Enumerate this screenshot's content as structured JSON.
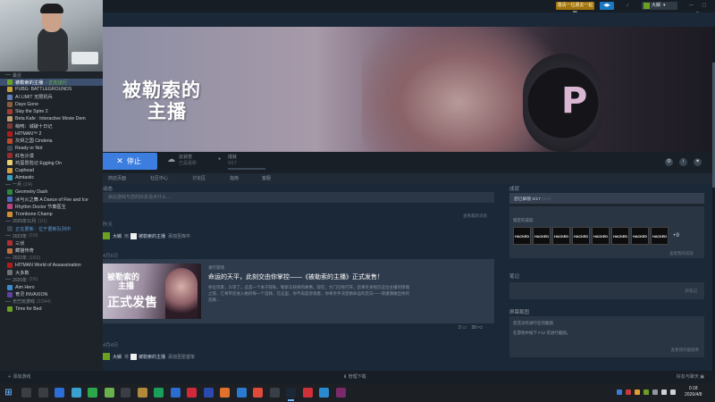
{
  "topbar": {
    "invite_label": "邀请一位朋友一起玩",
    "broadcast_icon": "broadcast-icon",
    "notification_icon": "bell-icon",
    "username": "大鳞",
    "window_controls": "— ▢ ✕"
  },
  "sidebar": {
    "sections": [
      {
        "header": "最近",
        "count": "",
        "items": [
          {
            "label": "被勒索的主播",
            "status": "- 正在运行",
            "color": "#6aa121",
            "active": true
          },
          {
            "label": "PUBG: BATTLEGROUNDS",
            "color": "#c9a13a"
          },
          {
            "label": "AI LIMIT 无限机兵",
            "color": "#5e7fb0"
          },
          {
            "label": "Days Gone",
            "color": "#8a5c3a"
          },
          {
            "label": "Slay the Spire 2",
            "color": "#a23c2e"
          },
          {
            "label": "Beta Kafe : Interactive Movie Dem",
            "color": "#c0a070"
          },
          {
            "label": "萌鸭：城破十日记",
            "color": "#7a3a3a"
          },
          {
            "label": "HITMAN™ 2",
            "color": "#b01c1c"
          },
          {
            "label": "灰烬之国 Cinderia",
            "color": "#c04a2a"
          },
          {
            "label": "Ready or Not",
            "color": "#3c4a58"
          },
          {
            "label": "红色沙漠",
            "color": "#9c2b2b"
          },
          {
            "label": "鸡蛋冒险记 Egging On",
            "color": "#e8d070"
          },
          {
            "label": "Cuphead",
            "color": "#d0a040"
          },
          {
            "label": "Aimtastic",
            "color": "#3aa0c0"
          }
        ]
      },
      {
        "header": "一月",
        "count": "(2/4)",
        "items": [
          {
            "label": "Geometry Dash",
            "color": "#2a8a3a"
          },
          {
            "label": "冰与火之舞 A Dance of Fire and Ice",
            "color": "#4a6ac0"
          },
          {
            "label": "Rhythm Doctor 节奏医生",
            "color": "#c04080"
          },
          {
            "label": "Trombone Champ",
            "color": "#d09030"
          }
        ]
      },
      {
        "header": "2025年11月",
        "count": "(1/1)",
        "items": [
          {
            "label": "正在更新：位于更新队列中",
            "color": "#3a4552",
            "highlight": true
          }
        ]
      },
      {
        "header": "2023年",
        "count": "(2/9)",
        "items": [
          {
            "label": "三伏",
            "color": "#b03030"
          },
          {
            "label": "藏猫传奇",
            "color": "#c07040"
          }
        ]
      },
      {
        "header": "2022年",
        "count": "(2/63)",
        "items": [
          {
            "label": "HITMAN World of Assassination",
            "color": "#b01c1c"
          },
          {
            "label": "大多数",
            "color": "#707070"
          }
        ]
      },
      {
        "header": "2020年",
        "count": "(2/6)",
        "items": [
          {
            "label": "Aim Hero",
            "color": "#3a8ad0"
          },
          {
            "label": "育灵 INVAXION",
            "color": "#6040a0"
          }
        ]
      },
      {
        "header": "无已玩游戏",
        "count": "(2/344)",
        "items": [
          {
            "label": "Time for Bed",
            "color": "#6aa121"
          }
        ]
      }
    ]
  },
  "hero": {
    "title_line1": "被勒索的",
    "title_line2": "主播",
    "headphone_letter": "P"
  },
  "playbar": {
    "stop_label": "停止",
    "cloud_label": "云状态",
    "cloud_value": "已是最新",
    "ach_label": "成就",
    "ach_value": "0/17"
  },
  "subnav": [
    "商店页面",
    "社区中心",
    "讨论区",
    "指南",
    "客服"
  ],
  "activity": {
    "section_label": "动态",
    "input_placeholder": "就此游戏与您的好友说点什么…",
    "view_all": "查看最新消息",
    "date1": "昨天",
    "feed1": {
      "user": "大鳞",
      "verb": "用",
      "game": "被勒索的主播",
      "action": "添加至库中"
    },
    "date2": "4月6日",
    "news": {
      "thumb_line1": "被勒索的",
      "thumb_line2": "主播",
      "thumb_badge": "正式发售",
      "kind": "发行游戏",
      "headline": "命运的天平，此刻交由你掌控——《被勒索的主播》正式发售！",
      "summary": "各位玩家，久等了。这是一个关于隐私、勒索与抉择的故事。现在，大门已经打开。您将亲身经历这位主播的惊魂之夜，它将带您进入她的每一个选择。在这里，你不再是旁观者，你将亲手决定她命运的走向——请谨慎做出你的选择…",
      "comments": "2",
      "likes": "30"
    },
    "date3": "4月4日",
    "feed2": {
      "user": "大鳞",
      "verb": "将",
      "game": "被勒索的主播",
      "action": "添加至愿望单"
    }
  },
  "achievements": {
    "section_label": "成就",
    "unlocked": "您已解锁 0/17",
    "unlocked_pct": "(0%)",
    "locked_label": "锁定的成就",
    "badges": [
      "HACKED",
      "HACKED",
      "HACKED",
      "HACKED",
      "HACKED",
      "HACKED",
      "HACKED",
      "HACKED"
    ],
    "more": "+9",
    "view_all": "查看我的成就"
  },
  "notes": {
    "section_label": "笔记",
    "link": "新笔记"
  },
  "screenshots": {
    "section_label": "屏幕截图",
    "line1": "您还没有进行任何截图",
    "line2": "在游戏中按下 F12 可进行截图。",
    "link": "查看我的截图库"
  },
  "steambar": {
    "add_game": "添加游戏",
    "downloads": "管理下载",
    "friends": "好友与聊天"
  },
  "taskbar": {
    "time": "0:18",
    "date": "2026/4/8"
  }
}
